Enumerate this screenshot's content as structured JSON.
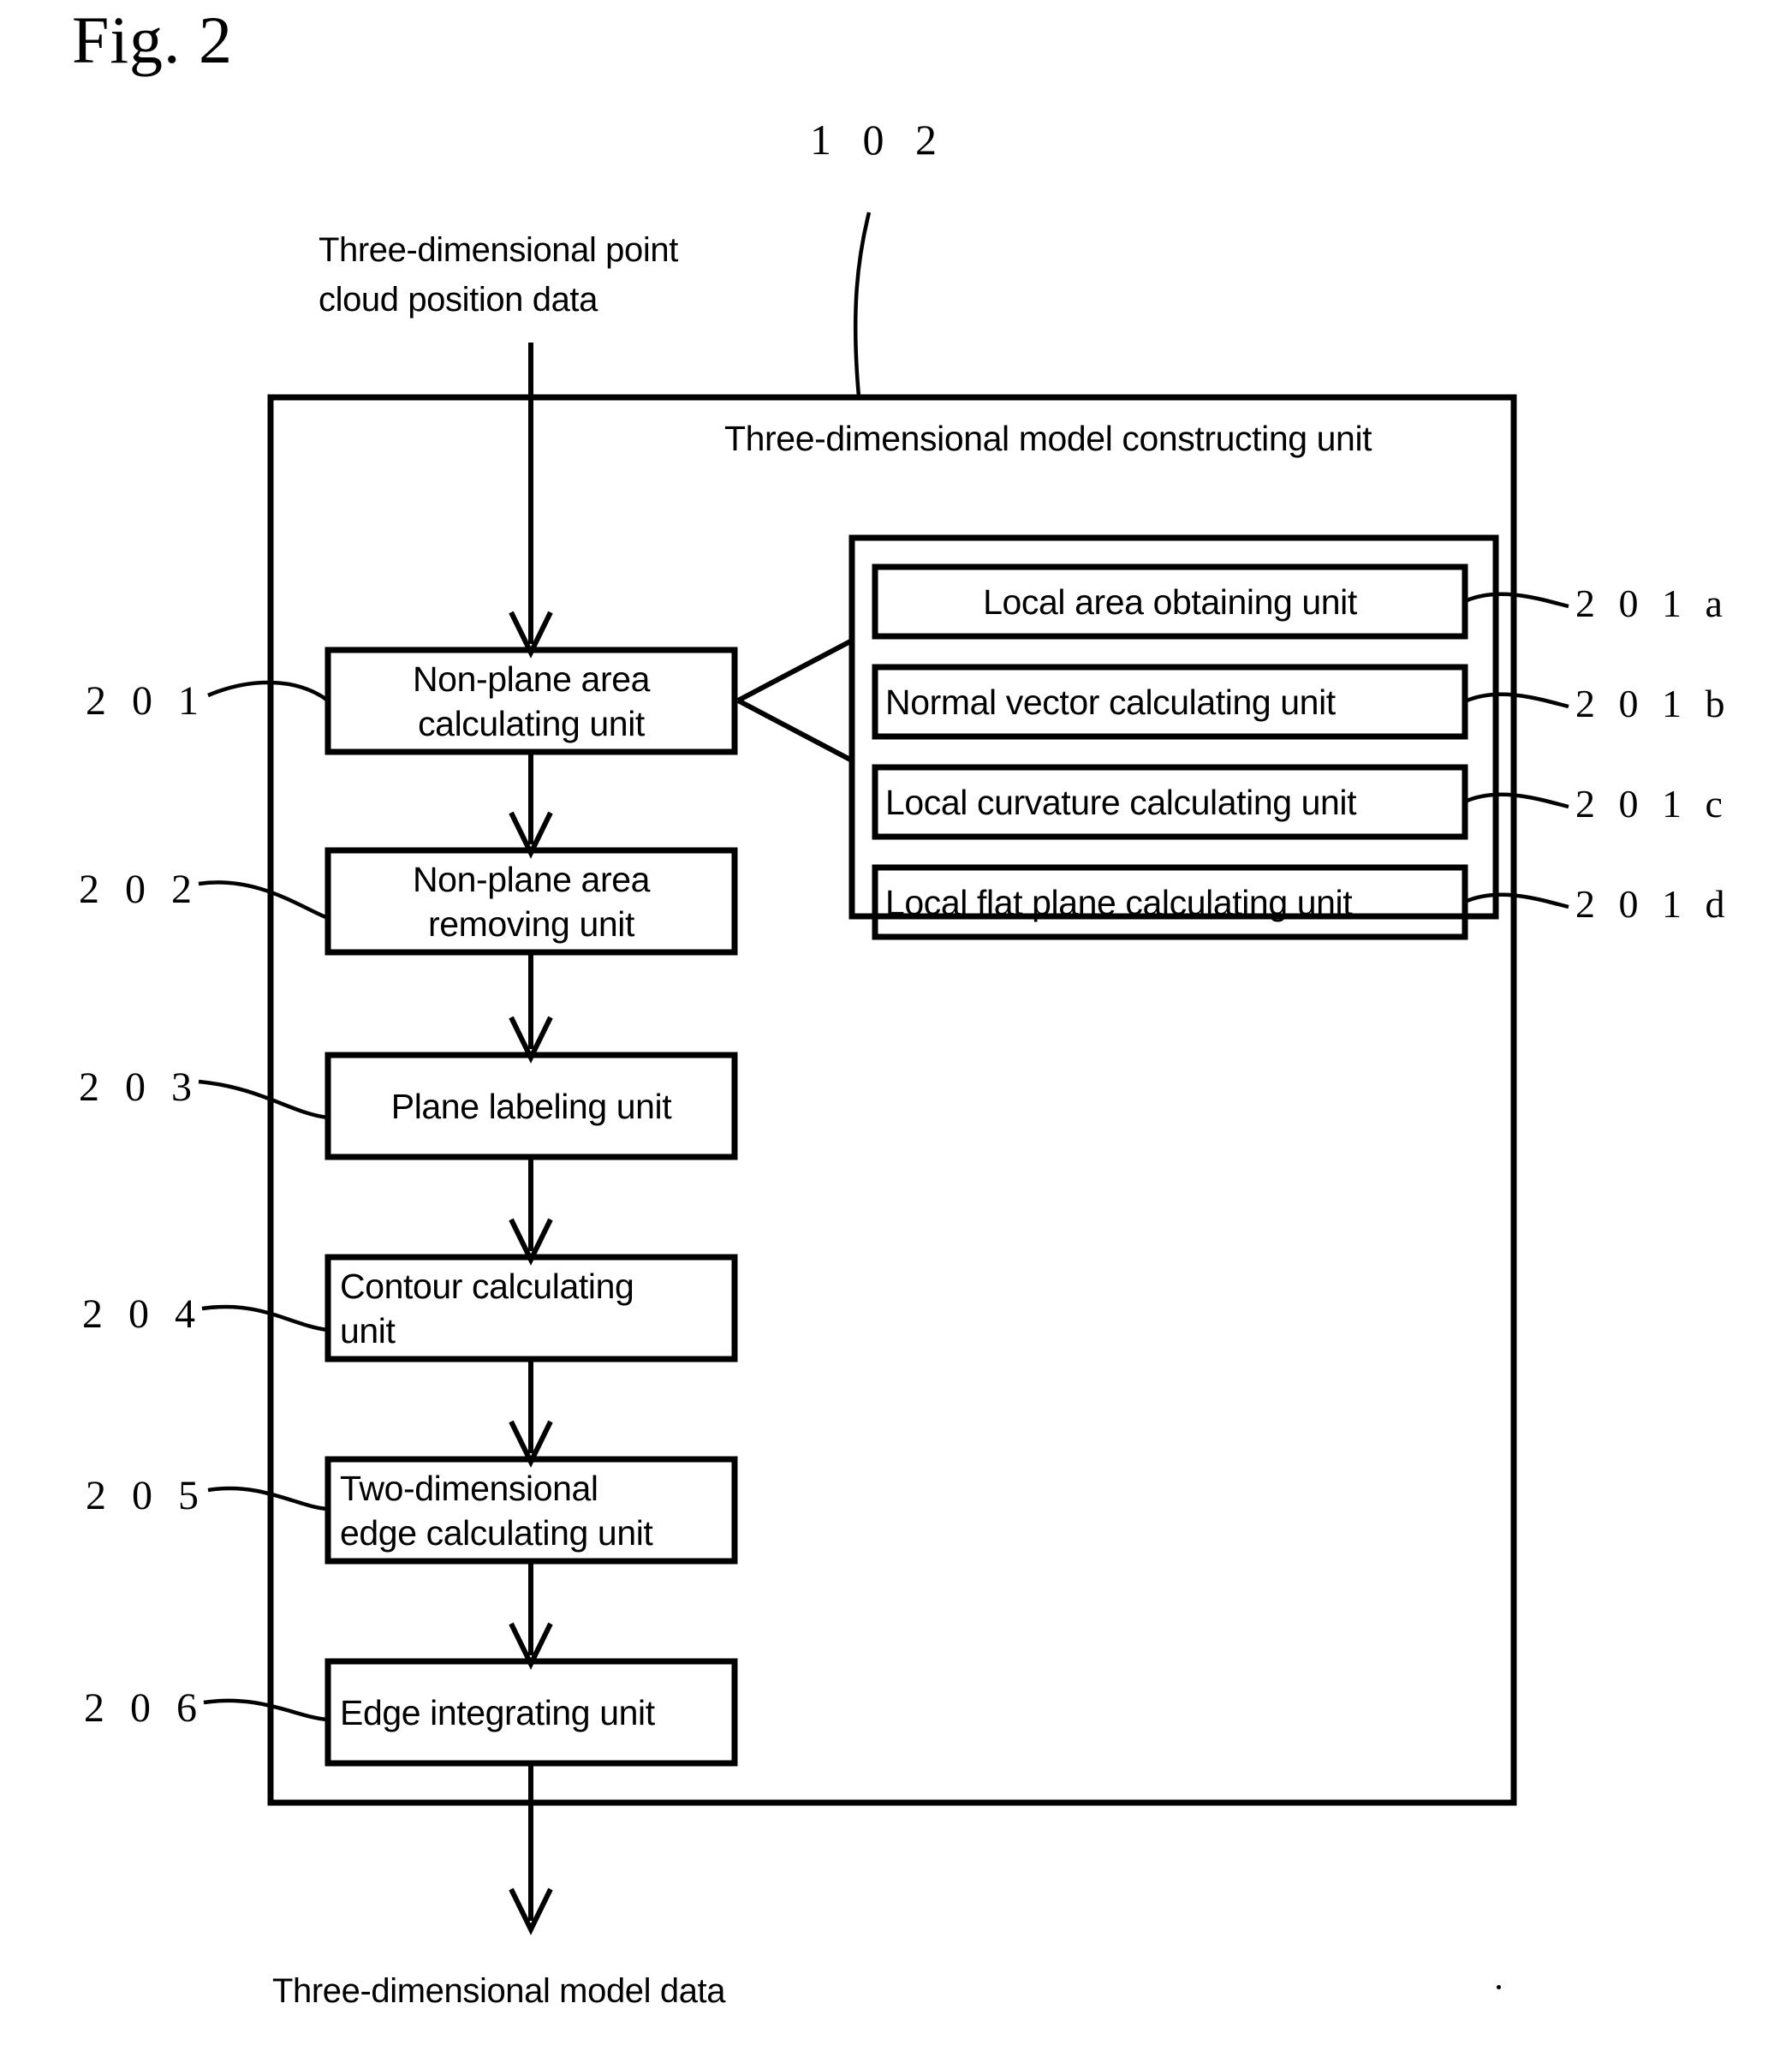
{
  "figure": {
    "title": "Fig. 2",
    "reference_numeral": "1 0 2",
    "container_label": "Three-dimensional model constructing unit"
  },
  "io": {
    "input_label_line1": "Three-dimensional point",
    "input_label_line2": "cloud position data",
    "output_label": "Three-dimensional model data"
  },
  "pipeline": [
    {
      "ref": "2 0 1",
      "label_line1": "Non-plane area",
      "label_line2": "calculating unit",
      "align": "center"
    },
    {
      "ref": "2 0 2",
      "label_line1": "Non-plane area",
      "label_line2": "removing unit",
      "align": "center"
    },
    {
      "ref": "2 0 3",
      "label_line1": "Plane labeling unit",
      "label_line2": "",
      "align": "center"
    },
    {
      "ref": "2 0 4",
      "label_line1": "Contour calculating",
      "label_line2": "unit",
      "align": "left"
    },
    {
      "ref": "2 0 5",
      "label_line1": "Two-dimensional",
      "label_line2": "edge calculating unit",
      "align": "left"
    },
    {
      "ref": "2 0 6",
      "label_line1": "Edge integrating unit",
      "label_line2": "",
      "align": "left"
    }
  ],
  "subunits": [
    {
      "ref": "2 0 1 a",
      "label": "Local area obtaining unit",
      "align": "center"
    },
    {
      "ref": "2 0 1 b",
      "label": "Normal vector calculating unit",
      "align": "left"
    },
    {
      "ref": "2 0 1 c",
      "label": "Local curvature calculating unit",
      "align": "left"
    },
    {
      "ref": "2 0 1 d",
      "label": "Local flat plane calculating unit",
      "align": "left"
    }
  ],
  "style": {
    "ink": "#000000",
    "paper": "#ffffff"
  }
}
